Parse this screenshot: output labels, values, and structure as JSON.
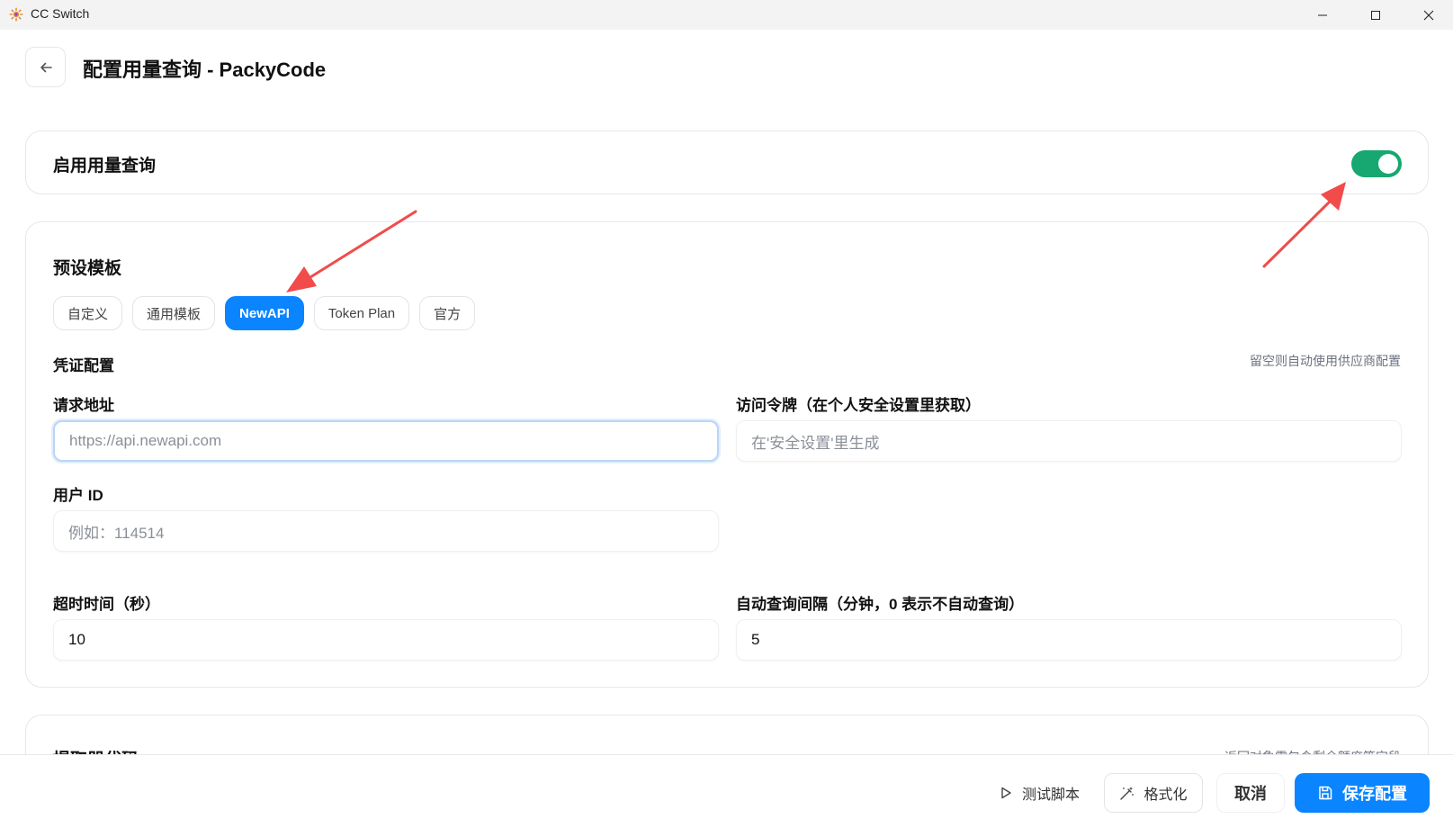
{
  "window": {
    "title": "CC Switch",
    "icons": {
      "logo": "sun-logo-icon",
      "minimize": "minimize-icon",
      "maximize": "maximize-icon",
      "close": "close-icon"
    }
  },
  "header": {
    "back_icon": "arrow-left-icon",
    "title": "配置用量查询 - PackyCode"
  },
  "enable": {
    "label": "启用用量查询",
    "enabled": true
  },
  "templates": {
    "title": "预设模板",
    "options": [
      "自定义",
      "通用模板",
      "NewAPI",
      "Token Plan",
      "官方"
    ],
    "selected": "NewAPI"
  },
  "credentials": {
    "title": "凭证配置",
    "hint": "留空则自动使用供应商配置",
    "url_label": "请求地址",
    "url_placeholder": "https://api.newapi.com",
    "token_label": "访问令牌（在个人安全设置里获取）",
    "token_placeholder": "在'安全设置'里生成",
    "uid_label": "用户 ID",
    "uid_placeholder": "例如：114514",
    "timeout_label": "超时时间（秒）",
    "timeout_value": "10",
    "interval_label": "自动查询间隔（分钟，0 表示不自动查询）",
    "interval_value": "5"
  },
  "extractor": {
    "title": "提取器代码",
    "hint": "返回对象需包含剩余额度等字段"
  },
  "footer": {
    "test_label": "测试脚本",
    "format_label": "格式化",
    "cancel_label": "取消",
    "save_label": "保存配置",
    "icons": {
      "test": "play-icon",
      "format": "magic-wand-icon",
      "save": "save-icon"
    }
  },
  "colors": {
    "accent": "#0a84ff",
    "toggle_on": "#16a870",
    "annotation_arrow": "#f24b4b"
  }
}
